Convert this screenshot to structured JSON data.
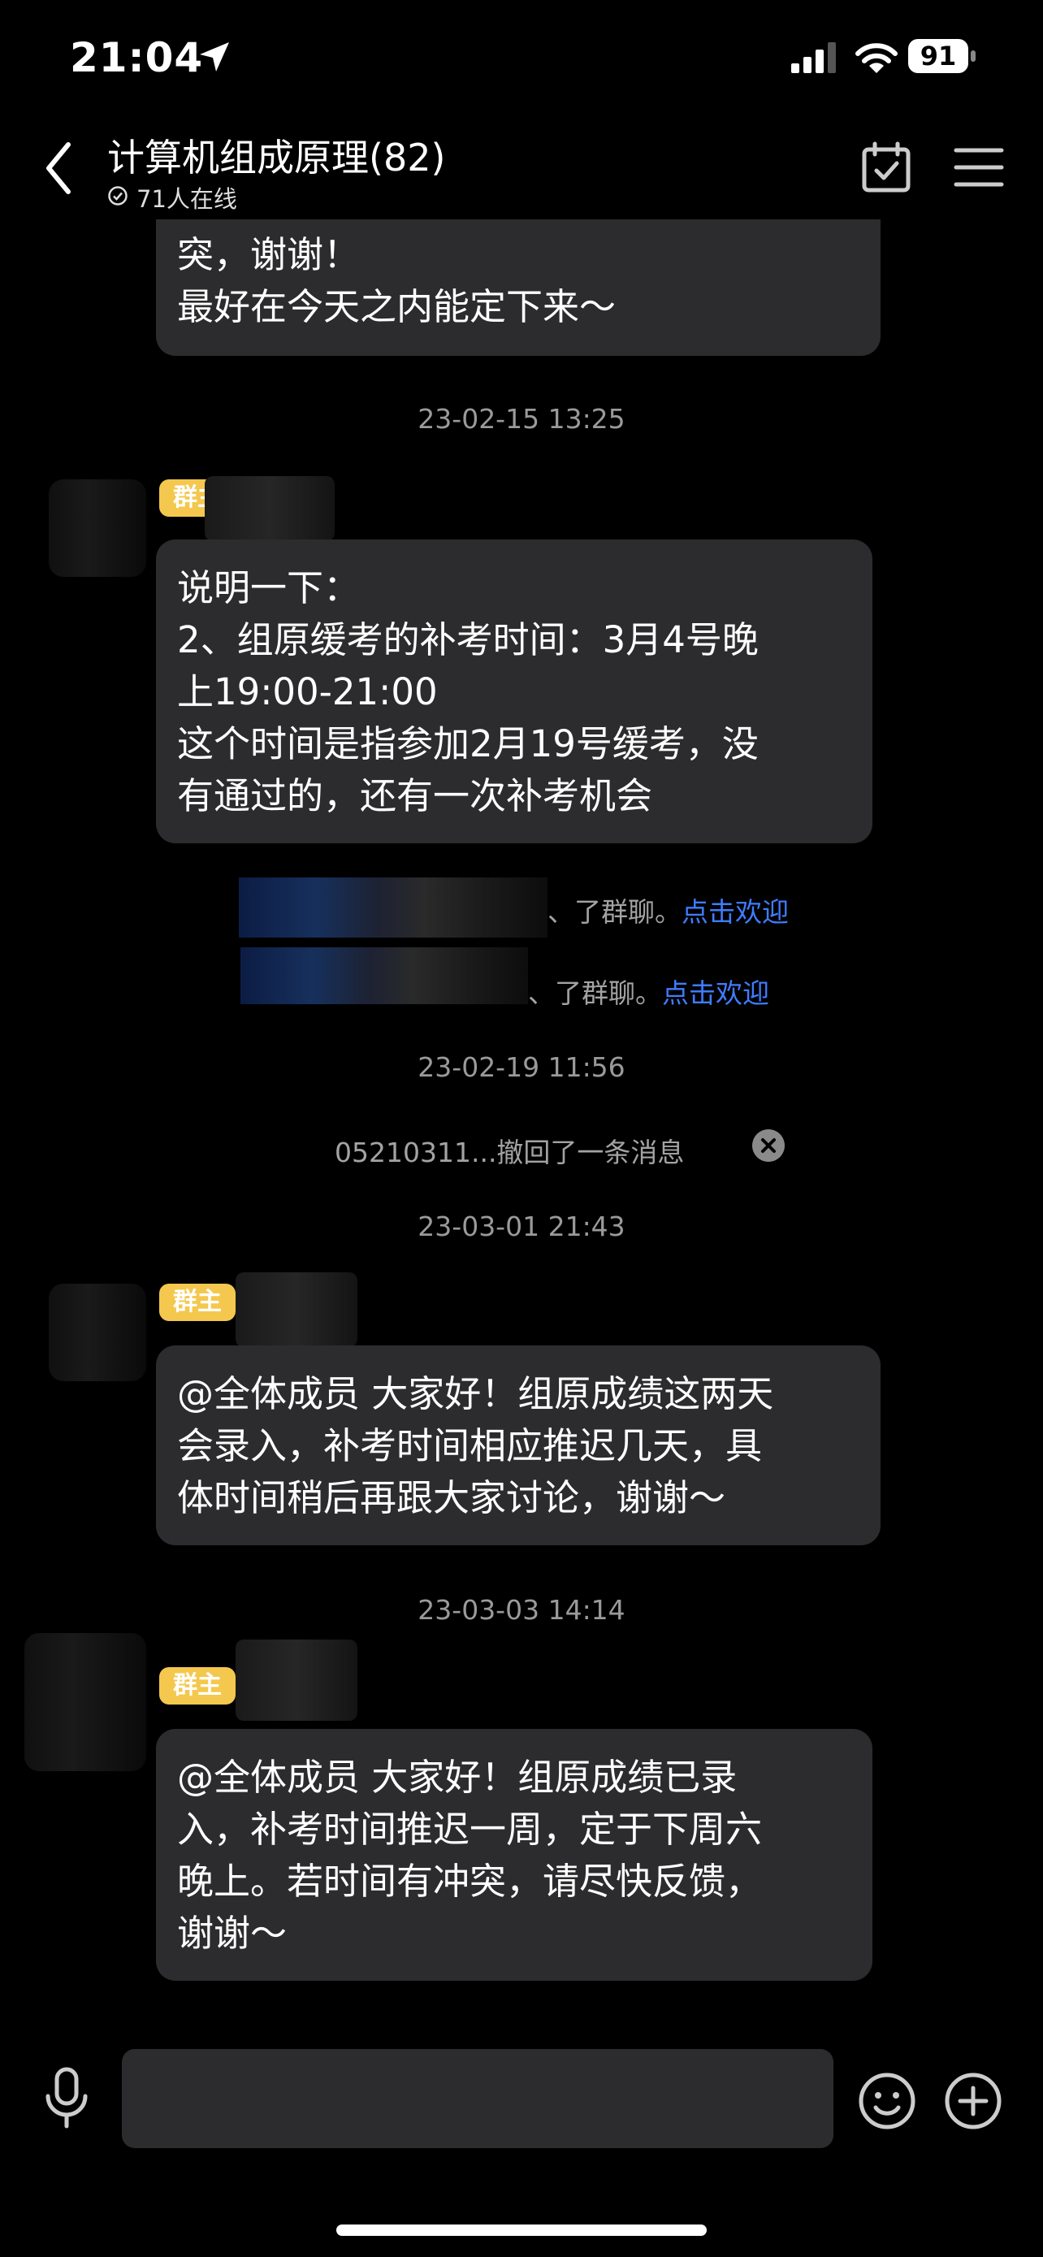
{
  "status_bar": {
    "time": "21:04",
    "battery": "91"
  },
  "nav": {
    "title": "计算机组成原理(82)",
    "subtitle": "71人在线"
  },
  "messages": [
    {
      "lines": [
        "突，谢谢！",
        "最好在今天之内能定下来～"
      ]
    },
    {
      "timestamp": "23-02-15 13:25",
      "badge": "群主",
      "lines": [
        "说明一下：",
        "2、组原缓考的补考时间：3月4号晚",
        "上19:00-21:00",
        "这个时间是指参加2月19号缓考，没",
        "有通过的，还有一次补考机会"
      ]
    },
    {
      "system_1": {
        "text": "、了群聊。",
        "link": "点击欢迎"
      },
      "system_2": {
        "text": "、了群聊。",
        "link": "点击欢迎"
      }
    },
    {
      "timestamp": "23-02-19 11:56",
      "recall": "05210311...撤回了一条消息"
    },
    {
      "timestamp": "23-03-01 21:43",
      "badge": "群主",
      "lines": [
        "@全体成员 大家好！组原成绩这两天",
        "会录入，补考时间相应推迟几天，具",
        "体时间稍后再跟大家讨论，谢谢～"
      ]
    },
    {
      "timestamp": "23-03-03 14:14",
      "badge": "群主",
      "lines": [
        "@全体成员 大家好！组原成绩已录",
        "入，补考时间推迟一周，定于下周六",
        "晚上。若时间有冲突，请尽快反馈，",
        "谢谢～"
      ]
    }
  ],
  "input": {
    "placeholder": ""
  },
  "icons": [
    "location-arrow-icon",
    "signal-icon",
    "wifi-icon",
    "battery-icon",
    "back-icon",
    "online-status-icon",
    "calendar-check-icon",
    "menu-icon",
    "close-icon",
    "mic-icon",
    "emoji-icon",
    "plus-icon"
  ]
}
